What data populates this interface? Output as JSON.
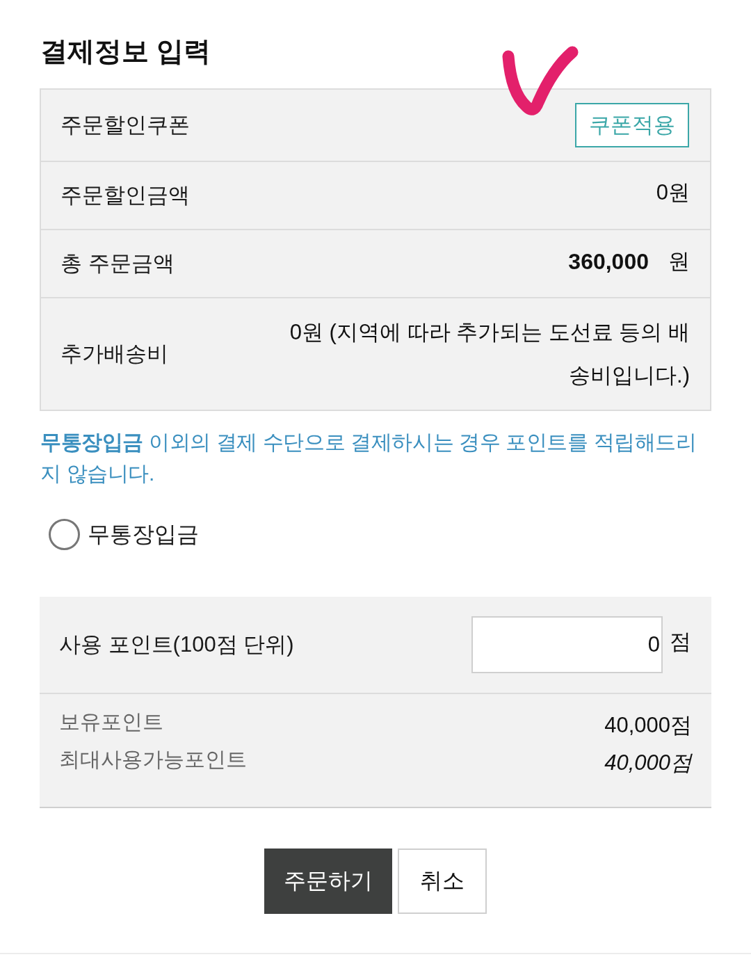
{
  "title": "결제정보 입력",
  "annotation": {
    "kind": "check"
  },
  "summary_rows": [
    {
      "kind": "button",
      "label": "주문할인쿠폰",
      "button": "쿠폰적용"
    },
    {
      "kind": "amount",
      "label": "주문할인금액",
      "value": "0원"
    },
    {
      "kind": "total",
      "label": "총 주문금액",
      "value": "360,000",
      "unit": "원"
    },
    {
      "kind": "note",
      "label": "추가배송비",
      "value": "0원 (지역에 따라 추가되는 도선료 등의 배송비입니다.)"
    }
  ],
  "notice": "**무통장입금** 이외의 결제 수단으로 결제하시는 경우 포인트를 적립해드리지 않습니다.",
  "payment_methods": [
    {
      "label": "무통장입금",
      "selected": false
    }
  ],
  "points": {
    "label": "사용 포인트(100점 단위)",
    "input_value": "0",
    "unit": "점",
    "balances": [
      {
        "label": "보유포인트",
        "value": "40,000점",
        "italic": false
      },
      {
        "label": "최대사용가능포인트",
        "value": "40,000점",
        "italic": true
      }
    ]
  },
  "buttons": [
    {
      "label": "주문하기",
      "kind": "primary"
    },
    {
      "label": "취소",
      "kind": "secondary"
    }
  ]
}
